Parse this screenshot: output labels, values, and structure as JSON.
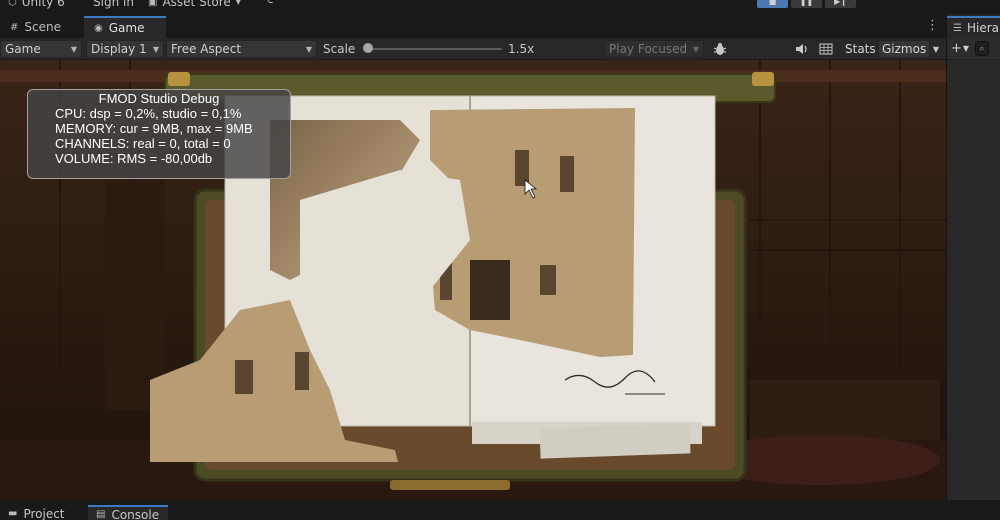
{
  "topbar": {
    "app_name": "Unity 6",
    "sign_in": "Sign in",
    "asset_store": "Asset Store",
    "play_icon": "play-icon",
    "pause_icon": "pause-icon",
    "step_icon": "step-icon"
  },
  "tabs": {
    "scene": "Scene",
    "game": "Game"
  },
  "toolbar": {
    "view_mode": "Game",
    "display": "Display 1",
    "aspect": "Free Aspect",
    "scale_label": "Scale",
    "scale_value": "1.5x",
    "scale_fraction": 0.03,
    "play_focused": "Play Focused",
    "stats": "Stats",
    "gizmos": "Gizmos"
  },
  "hierarchy": {
    "tab": "Hierarchy"
  },
  "fmod": {
    "title": "FMOD Studio Debug",
    "cpu": "CPU: dsp = 0,2%, studio = 0,1%",
    "memory": "MEMORY: cur = 9MB, max = 9MB",
    "channels": "CHANNELS: real = 0, total = 0",
    "volume": "VOLUME: RMS = -80,00db"
  },
  "bottom": {
    "project": "Project",
    "console": "Console"
  },
  "colors": {
    "accent": "#3a79c4",
    "play_active": "#4d79b3",
    "panel": "#282828",
    "chrome": "#191919"
  }
}
